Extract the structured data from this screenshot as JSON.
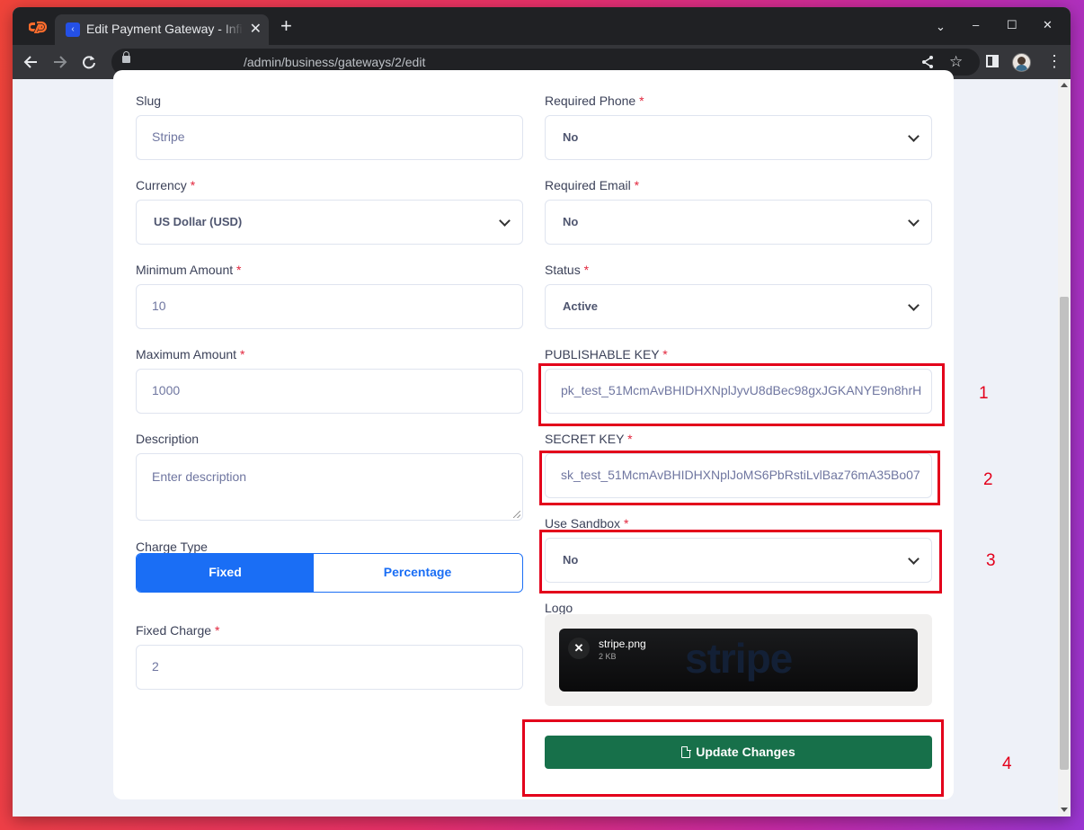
{
  "browser": {
    "tab_title": "Edit Payment Gateway - Infinity",
    "new_tab": "+",
    "url": "/admin/business/gateways/2/edit",
    "window_controls": {
      "menu": "⌄",
      "minimize": "–",
      "maximize": "☐",
      "close": "✕"
    }
  },
  "form": {
    "slug": {
      "label": "Slug",
      "value": "Stripe"
    },
    "required_phone": {
      "label": "Required Phone",
      "value": "No"
    },
    "currency": {
      "label": "Currency",
      "value": "US Dollar (USD)"
    },
    "required_email": {
      "label": "Required Email",
      "value": "No"
    },
    "minimum_amount": {
      "label": "Minimum Amount",
      "value": "10"
    },
    "status": {
      "label": "Status",
      "value": "Active"
    },
    "maximum_amount": {
      "label": "Maximum Amount",
      "value": "1000"
    },
    "publishable_key": {
      "label": "PUBLISHABLE KEY",
      "value": "pk_test_51McmAvBHIDHXNplJyvU8dBec98gxJGKANYE9n8hrH"
    },
    "description": {
      "label": "Description",
      "placeholder": "Enter description"
    },
    "secret_key": {
      "label": "SECRET KEY",
      "value": "sk_test_51McmAvBHIDHXNplJoMS6PbRstiLvlBaz76mA35Bo07"
    },
    "charge_type": {
      "label": "Charge Type",
      "options": [
        "Fixed",
        "Percentage"
      ],
      "selected": "Fixed"
    },
    "use_sandbox": {
      "label": "Use Sandbox",
      "value": "No"
    },
    "fixed_charge": {
      "label": "Fixed Charge",
      "value": "2"
    },
    "logo": {
      "label": "Logo",
      "file_name": "stripe.png",
      "file_size": "2 KB",
      "preview_text": "stripe"
    },
    "required_mark": "*",
    "submit_label": "Update Changes"
  },
  "annotations": [
    "1",
    "2",
    "3",
    "4"
  ],
  "colors": {
    "primary": "#1a6ef5",
    "success": "#17704a",
    "required": "#e2263d",
    "annotation": "#e3001b"
  }
}
